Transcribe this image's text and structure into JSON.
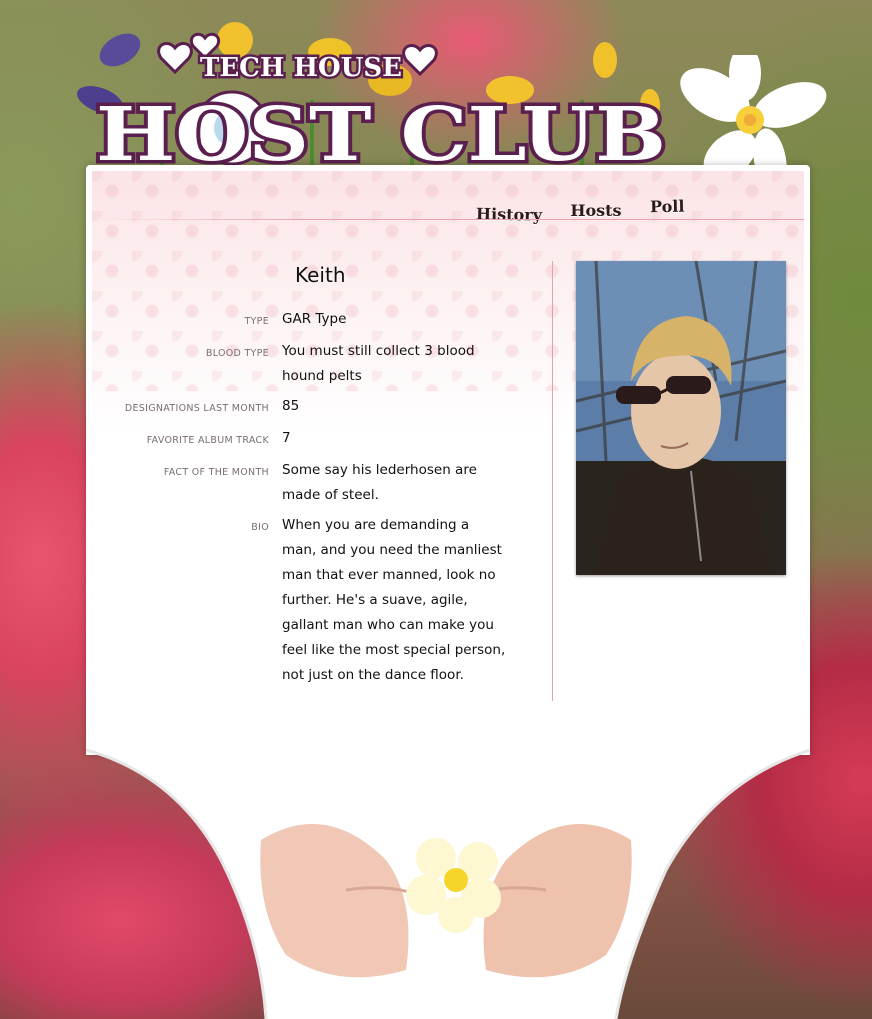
{
  "header": {
    "small_title": "TECH HOUSE",
    "big_title": "HOST CLUB"
  },
  "nav": {
    "history": "History",
    "hosts": "Hosts",
    "poll": "Poll"
  },
  "profile": {
    "name": "Keith",
    "fields": [
      {
        "label": "TYPE",
        "value": "GAR Type"
      },
      {
        "label": "BLOOD TYPE",
        "value": "You must still collect 3 blood hound pelts"
      },
      {
        "label": "DESIGNATIONS LAST MONTH",
        "value": "85"
      },
      {
        "label": "FAVORITE ALBUM TRACK",
        "value": "7"
      },
      {
        "label": "FACT OF THE MONTH",
        "value": "Some say his lederhosen are made of steel."
      },
      {
        "label": "BIO",
        "value": "When you are demanding a man, and you need the manliest man that ever manned, look no further. He's a suave, agile, gallant man who can make you feel like the most special person, not just on the dance floor."
      }
    ]
  },
  "colors": {
    "accent_pink": "#e0a3a9",
    "logo_purple": "#5a1f4e",
    "panel_bg": "#ffffff"
  },
  "icons": [
    "heart-icon",
    "daisy-icon",
    "plumeria-flower-icon",
    "primrose-flower-icon"
  ]
}
